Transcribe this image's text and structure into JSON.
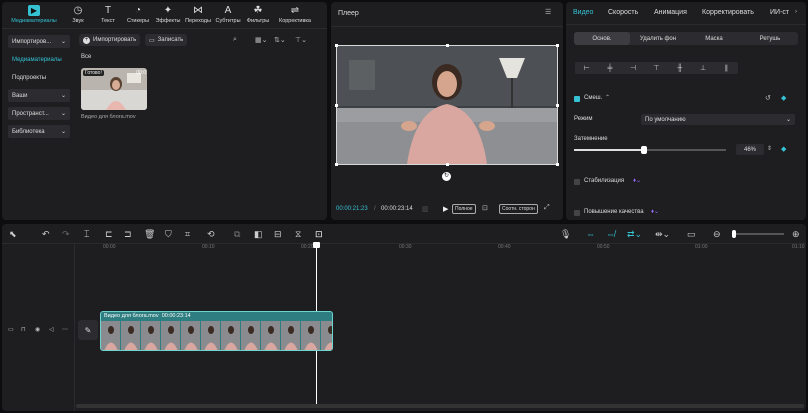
{
  "media_tabs": [
    {
      "label": "Медиаматериалы",
      "icon": "media-icon"
    },
    {
      "label": "Звук",
      "icon": "audio-icon"
    },
    {
      "label": "Текст",
      "icon": "text-icon"
    },
    {
      "label": "Стикеры",
      "icon": "sticker-icon"
    },
    {
      "label": "Эффекты",
      "icon": "effects-icon"
    },
    {
      "label": "Переходы",
      "icon": "transitions-icon"
    },
    {
      "label": "Субтитры",
      "icon": "captions-icon"
    },
    {
      "label": "Фильтры",
      "icon": "filters-icon"
    },
    {
      "label": "Коррективка",
      "icon": "adjust-icon"
    }
  ],
  "sidebar": {
    "import": "Импортиров...",
    "media": "Медиаматериалы",
    "subprojects": "Подпроекты",
    "yours": "Ваши",
    "space": "Пространст...",
    "library": "Библиотека"
  },
  "media": {
    "import_btn": "Импортировать",
    "record_btn": "Записать",
    "filter_all": "Все",
    "thumb_status": "Готово!",
    "thumb_duration": "00:0",
    "thumb_name": "Видео для блога.mov"
  },
  "player": {
    "title": "Плеер",
    "current_time": "00:00:21:23",
    "separator": "/",
    "total_time": "00:00:23:14",
    "full_btn": "Полное",
    "ratio_btn": "Соотн. сторон"
  },
  "props": {
    "tabs": [
      "Видео",
      "Скорость",
      "Анимация",
      "Корректировать",
      "ИИ-ст"
    ],
    "sub_tabs": [
      "Основ.",
      "Удалить фон",
      "Маска",
      "Ретушь"
    ],
    "blend_label": "Смеш.",
    "mode_label": "Режим",
    "mode_value": "По умолчанию",
    "opacity_label": "Затемнение",
    "opacity_value": "46%",
    "opacity_fraction": 0.46,
    "stabilize_label": "Стабилизация",
    "quality_label": "Повышение качества"
  },
  "timeline": {
    "ruler": [
      "00:00",
      "00:10",
      "00:20",
      "00:30",
      "00:40",
      "00:50",
      "01:00",
      "01:10"
    ],
    "clip_name": "Видео для блога.mov",
    "clip_duration": "00:00:23:14",
    "playhead_fraction": 0.925
  },
  "colors": {
    "accent": "#35c3d4",
    "clip": "#2e7d80"
  }
}
